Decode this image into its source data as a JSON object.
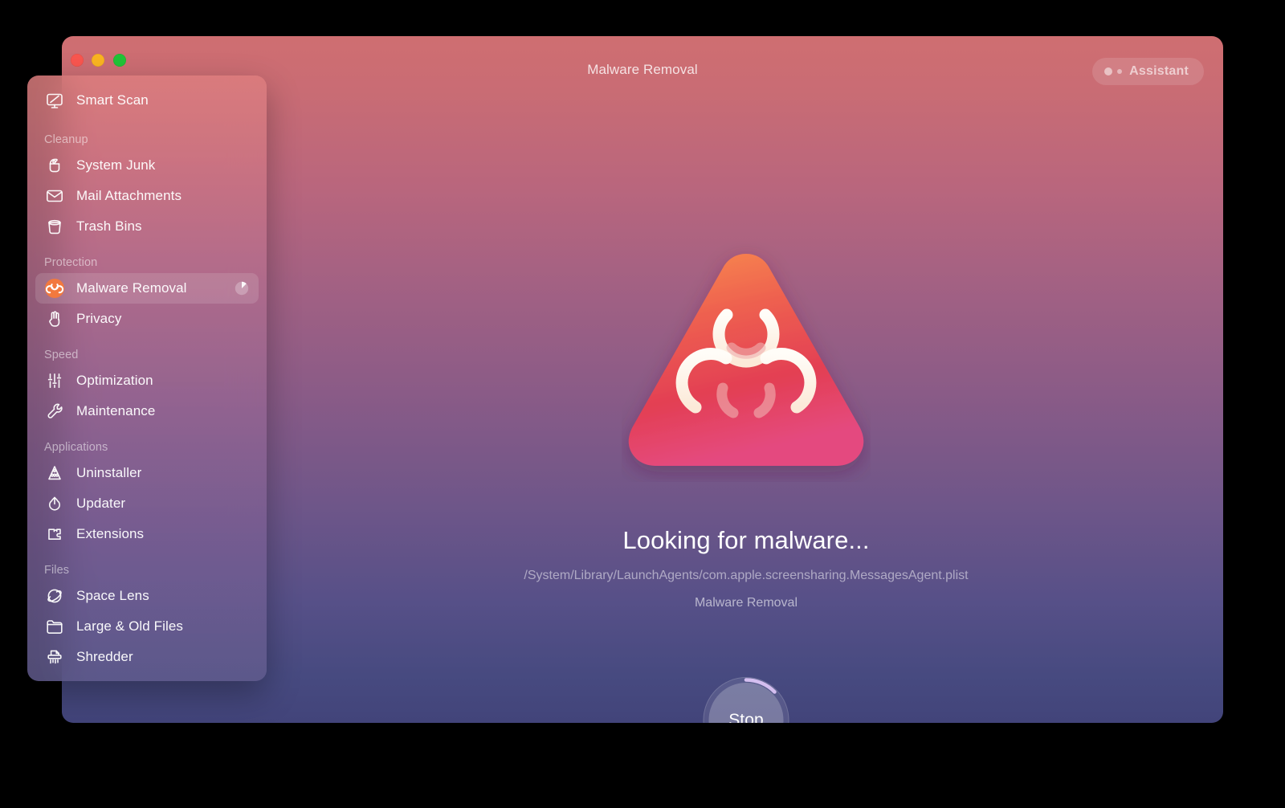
{
  "window": {
    "title": "Malware Removal",
    "traffic_lights": [
      {
        "name": "close",
        "color": "#f9564f"
      },
      {
        "name": "minimize",
        "color": "#fab421"
      },
      {
        "name": "maximize",
        "color": "#21c337"
      }
    ],
    "assistant_button": {
      "label": "Assistant",
      "icon": "two-dots-icon"
    }
  },
  "sidebar": {
    "groups": [
      {
        "section": null,
        "items": [
          {
            "label": "Smart Scan",
            "icon": "monitor-scan-icon",
            "selected": false
          }
        ]
      },
      {
        "section": "Cleanup",
        "items": [
          {
            "label": "System Junk",
            "icon": "broom-junk-icon",
            "selected": false
          },
          {
            "label": "Mail Attachments",
            "icon": "envelope-icon",
            "selected": false
          },
          {
            "label": "Trash Bins",
            "icon": "trash-bin-icon",
            "selected": false
          }
        ]
      },
      {
        "section": "Protection",
        "items": [
          {
            "label": "Malware Removal",
            "icon": "biohazard-icon",
            "selected": true,
            "progress_indicator": true
          },
          {
            "label": "Privacy",
            "icon": "hand-icon",
            "selected": false
          }
        ]
      },
      {
        "section": "Speed",
        "items": [
          {
            "label": "Optimization",
            "icon": "sliders-icon",
            "selected": false
          },
          {
            "label": "Maintenance",
            "icon": "wrench-icon",
            "selected": false
          }
        ]
      },
      {
        "section": "Applications",
        "items": [
          {
            "label": "Uninstaller",
            "icon": "app-grid-icon",
            "selected": false
          },
          {
            "label": "Updater",
            "icon": "arrow-refresh-icon",
            "selected": false
          },
          {
            "label": "Extensions",
            "icon": "puzzle-piece-icon",
            "selected": false
          }
        ]
      },
      {
        "section": "Files",
        "items": [
          {
            "label": "Space Lens",
            "icon": "planet-lens-icon",
            "selected": false
          },
          {
            "label": "Large & Old Files",
            "icon": "folder-icon",
            "selected": false
          },
          {
            "label": "Shredder",
            "icon": "shredder-icon",
            "selected": false
          }
        ]
      }
    ]
  },
  "main": {
    "hero_icon": "biohazard-triangle-icon",
    "status_title": "Looking for malware...",
    "status_path": "/System/Library/LaunchAgents/com.apple.screensharing.MessagesAgent.plist",
    "status_module": "Malware Removal",
    "stop_button": {
      "label": "Stop",
      "progress_percent": 22
    }
  },
  "colors": {
    "background_top": "#cf6e71",
    "background_mid": "#8a5b87",
    "background_bottom": "#42447a",
    "hazard_orange": "#f5834f",
    "hazard_red": "#e2414f",
    "hazard_pink": "#e14a7d",
    "progress_arc": "#d5bff0"
  }
}
